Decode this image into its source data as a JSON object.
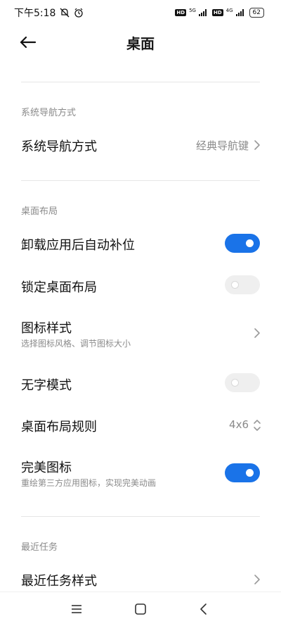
{
  "status_bar": {
    "time": "下午5:18",
    "hd1": "HD",
    "net1": "5G",
    "hd2": "HD",
    "net2": "4G",
    "battery": "62"
  },
  "header": {
    "title": "桌面",
    "back_icon": "arrow-left-icon"
  },
  "sections": {
    "nav": {
      "header": "系统导航方式",
      "item_title": "系统导航方式",
      "item_value": "经典导航键"
    },
    "layout": {
      "header": "桌面布局",
      "auto_fill": {
        "title": "卸载应用后自动补位",
        "on": true
      },
      "lock": {
        "title": "锁定桌面布局",
        "on": false
      },
      "icon_style": {
        "title": "图标样式",
        "subtitle": "选择图标风格、调节图标大小"
      },
      "no_text": {
        "title": "无字模式",
        "on": false
      },
      "grid": {
        "title": "桌面布局规则",
        "value": "4x6"
      },
      "perfect_icons": {
        "title": "完美图标",
        "subtitle": "重绘第三方应用图标，实现完美动画",
        "on": true
      }
    },
    "recents": {
      "header": "最近任务",
      "style": {
        "title": "最近任务样式"
      }
    }
  },
  "navbar": {
    "menu_icon": "menu-icon",
    "home_icon": "home-square-icon",
    "back_icon": "back-chevron-icon"
  },
  "colors": {
    "accent": "#1a73e8",
    "toggle_off": "#efefef",
    "secondary_text": "#8a8a8a"
  }
}
